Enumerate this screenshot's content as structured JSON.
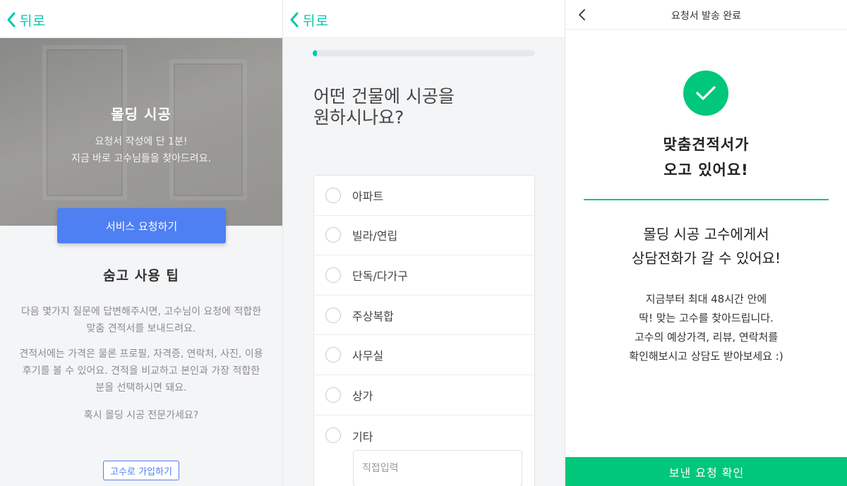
{
  "screen1": {
    "back_label": "뒤로",
    "hero_title": "몰딩 시공",
    "hero_sub1": "요청서 작성에 단 1분!",
    "hero_sub2": "지금 바로 고수님들을 찾아드려요.",
    "cta_label": "서비스 요청하기",
    "tips_title": "숨고 사용 팁",
    "tips_p1_l1": "다음 몇가지 질문에 답변해주시면, 고수님이 요청에 적합한",
    "tips_p1_l2": "맞춤 견적서를 보내드려요.",
    "tips_p2_l1": "견적서에는 가격은 물론 프로필, 자격증, 연락처, 사진, 이용",
    "tips_p2_l2": "후기를 볼 수 있어요. 견적을 비교하고 본인과 가장 적합한",
    "tips_p2_l3": "분을 선택하시면 돼요.",
    "pro_question": "혹시 몰딩 시공 전문가세요?",
    "join_label": "고수로 가입하기"
  },
  "screen2": {
    "back_label": "뒤로",
    "progress": 0.02,
    "question_l1": "어떤 건물에 시공을",
    "question_l2": "원하시나요?",
    "options": [
      "아파트",
      "빌라/연립",
      "단독/다가구",
      "주상복합",
      "사무실",
      "상가",
      "기타"
    ],
    "direct_input_placeholder": "직접입력"
  },
  "screen3": {
    "title": "요청서 발송 완료",
    "done_l1": "맞춤견적서가",
    "done_l2": "오고 있어요!",
    "call_l1": "몰딩 시공 고수에게서",
    "call_l2": "상담전화가 갈 수 있어요!",
    "info_l1": "지금부터 최대 48시간 안에",
    "info_l2": "딱! 맞는 고수를 찾아드립니다.",
    "info_l3": "고수의 예상가격, 리뷰, 연락처를",
    "info_l4": "확인해보시고 상담도 받아보세요 :)",
    "confirm_label": "보낸 요청 확인"
  },
  "colors": {
    "accent_teal": "#00c7ae",
    "accent_green": "#00c77a",
    "primary_blue": "#4e7ff3"
  },
  "icons": {
    "back": "chevron-left-icon",
    "done": "check-circle-icon"
  }
}
